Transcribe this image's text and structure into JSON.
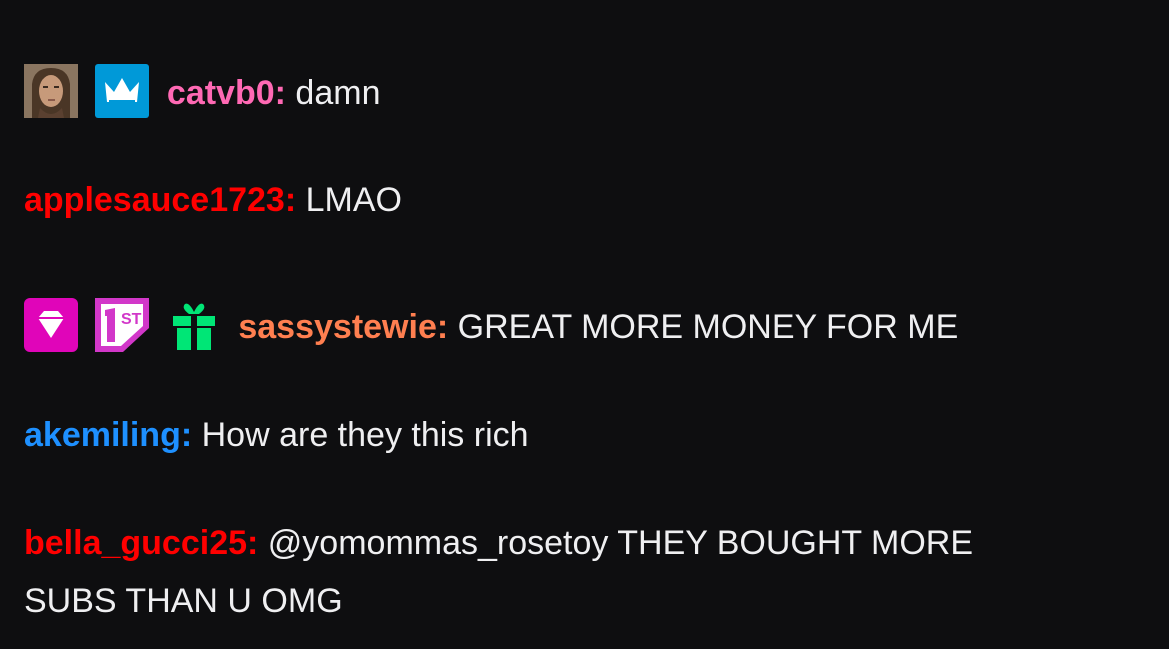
{
  "messages": [
    {
      "badges": [
        "avatar",
        "crown-icon"
      ],
      "username": "catvb0",
      "separator": ":",
      "text": "damn",
      "color": "#ff69b4"
    },
    {
      "badges": [],
      "username": "applesauce1723",
      "separator": ":",
      "text": "LMAO",
      "color": "#ff0000"
    },
    {
      "badges": [
        "diamond-icon",
        "first-place-icon",
        "gift-icon"
      ],
      "username": "sassystewie",
      "separator": ":",
      "text": "GREAT MORE MONEY FOR ME",
      "color": "#ff7f50"
    },
    {
      "badges": [],
      "username": "akemiling",
      "separator": ":",
      "text": "How are they this rich",
      "color": "#1e90ff"
    },
    {
      "badges": [],
      "username": "bella_gucci25",
      "separator": ":",
      "text": "@yomommas_rosetoy THEY BOUGHT MORE SUBS THAN U OMG",
      "color": "#ff0000"
    }
  ],
  "badge_colors": {
    "crown": "#0099d8",
    "diamond": "#e005b9",
    "first": "#d237c9",
    "gift": "#00e676"
  },
  "background": "#0e0e10"
}
